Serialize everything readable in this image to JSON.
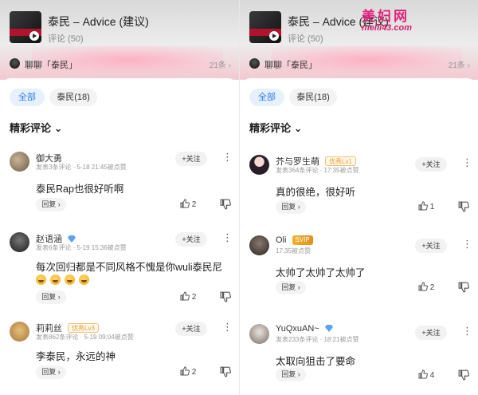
{
  "left": {
    "header": {
      "song_title": "泰民 – Advice (建议)",
      "comments_count": "评论 (50)",
      "chat_label": "聊聊「泰民」",
      "chat_count": "21条 ›"
    },
    "filters": [
      "全部",
      "泰民(18)"
    ],
    "sort_label": "精彩评论 ⌄",
    "comments": [
      {
        "user": "御大勇",
        "meta": "发表3条评论 · 5-18 21:45被点赞",
        "text": "泰民Rap也很好听啊",
        "likes": "2",
        "follow": "+关注",
        "reply": "回复 ›"
      },
      {
        "user": "赵语涵",
        "meta": "发表6条评论 · 5-19 15:36被点赞",
        "text": "每次回归都是不同风格不愧是你wuli泰民尼",
        "likes": "2",
        "follow": "+关注",
        "reply": "回复 ›"
      },
      {
        "user": "莉莉丝",
        "badge": "优秀Lv3",
        "meta": "发表862条评论 · 5-19 09:04被点赞",
        "text": "李泰民，永远的神",
        "likes": "2",
        "follow": "+关注",
        "reply": "回复 ›"
      }
    ]
  },
  "right": {
    "header": {
      "song_title": "泰民 – Advice (建议)",
      "comments_count": "评论 (50)",
      "chat_label": "聊聊「泰民」",
      "chat_count": "21条 ›"
    },
    "filters": [
      "全部",
      "泰民(18)"
    ],
    "sort_label": "精彩评论 ⌄",
    "comments": [
      {
        "user": "芥与罗生萌",
        "badge": "优秀Lv1",
        "meta": "发表364条评论 · 17:35被点赞",
        "text": "真的很绝，很好听",
        "likes": "1",
        "follow": "+关注",
        "reply": "回复 ›"
      },
      {
        "user": "Oli",
        "badge": "SVIP",
        "meta": "17:35被点赞",
        "text": "太帅了太帅了太帅了",
        "likes": "2",
        "follow": "+关注",
        "reply": "回复 ›"
      },
      {
        "user": "YuQxuAN~",
        "meta": "发表233条评论 · 18:21被点赞",
        "text": "太取向狙击了要命",
        "likes": "4",
        "follow": "+关注",
        "reply": "回复 ›"
      }
    ]
  },
  "watermark": {
    "top": "美妇网",
    "bottom": "meili43.com"
  },
  "icons": {
    "more": "more-vertical-icon",
    "like": "thumb-up-icon",
    "dislike": "thumb-down-icon",
    "play": "play-icon"
  }
}
